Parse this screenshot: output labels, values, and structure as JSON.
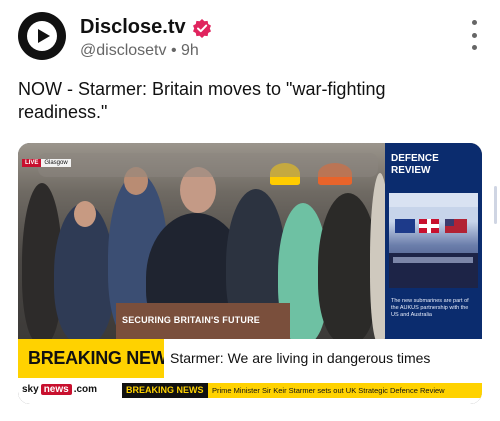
{
  "post": {
    "author_name": "Disclose.tv",
    "handle": "@disclosetv",
    "time": "9h",
    "text": "NOW - Starmer: Britain moves to \"war-fighting readiness.\""
  },
  "media": {
    "live_label": "LIVE",
    "location": "Glasgow",
    "podium_text": "SECURING BRITAIN'S FUTURE",
    "side_panel_title_1": "DEFENCE",
    "side_panel_title_2": "REVIEW",
    "side_panel_caption": "The new submarines are part of the AUKUS partnership with the US and Australia",
    "breaking_label": "BREAKING NEWS",
    "breaking_headline": "Starmer: We are living in dangerous times",
    "channel_sky": "sky",
    "channel_news": "news",
    "channel_com": ".com",
    "ticker_tag": "BREAKING NEWS",
    "ticker_text": "Prime Minister Sir Keir Starmer sets out UK Strategic Defence Review"
  },
  "colors": {
    "breaking_yellow": "#ffd200",
    "sky_red": "#c8102e",
    "panel_blue": "#0b2c6e",
    "verified_pink": "#e0245e"
  },
  "icons": [
    "avatar-logo-icon",
    "verified-badge-icon",
    "more-options-icon"
  ]
}
